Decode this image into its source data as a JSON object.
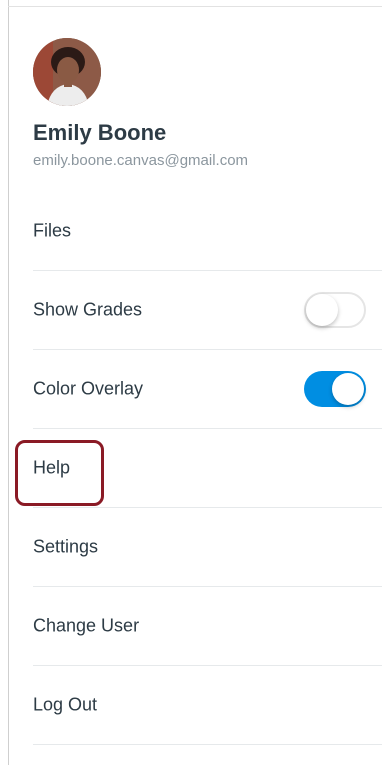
{
  "user": {
    "name": "Emily Boone",
    "email": "emily.boone.canvas@gmail.com"
  },
  "menu": {
    "items": [
      {
        "label": "Files"
      },
      {
        "label": "Show Grades",
        "toggle": {
          "on": false
        }
      },
      {
        "label": "Color Overlay",
        "toggle": {
          "on": true
        }
      },
      {
        "label": "Help",
        "highlighted": true
      },
      {
        "label": "Settings"
      },
      {
        "label": "Change User"
      },
      {
        "label": "Log Out"
      }
    ]
  },
  "colors": {
    "text_primary": "#2d3b45",
    "text_secondary": "#8b969e",
    "toggle_on": "#008ee2",
    "highlight_border": "#8a1a25"
  }
}
